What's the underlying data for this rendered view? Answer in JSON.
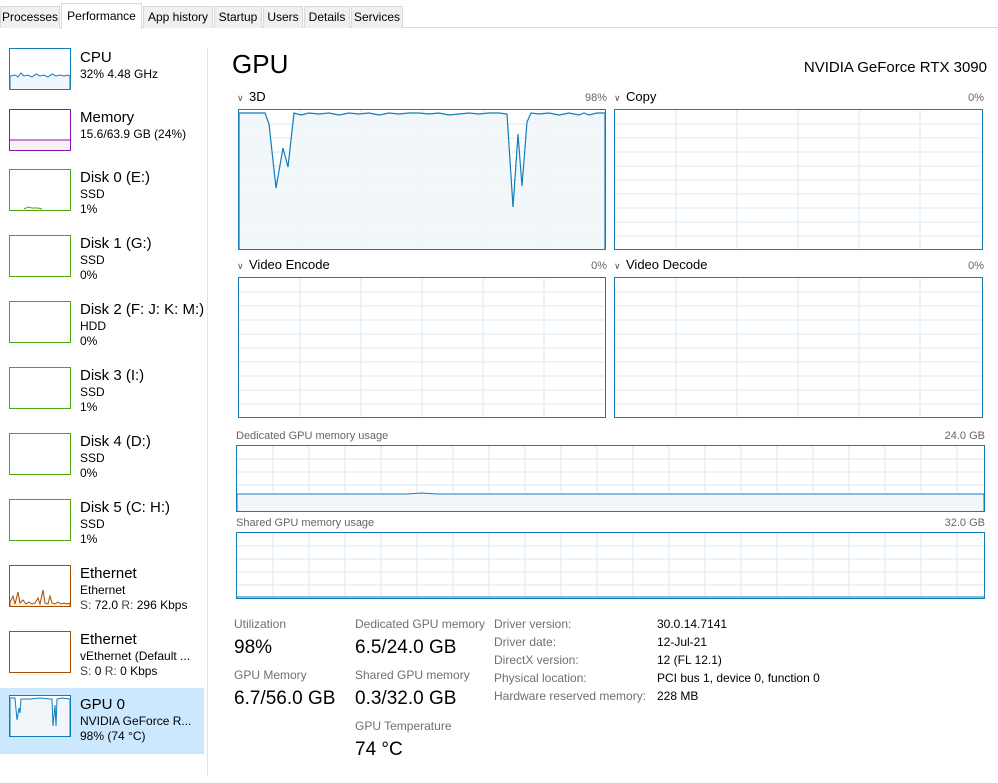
{
  "tabs": [
    "Processes",
    "Performance",
    "App history",
    "Startup",
    "Users",
    "Details",
    "Services"
  ],
  "active_tab": "Performance",
  "sidebar": {
    "items": [
      {
        "title": "CPU",
        "line1": "32%  4.48 GHz",
        "line2": "",
        "color": "#117dbb",
        "selected": false
      },
      {
        "title": "Memory",
        "line1": "15.6/63.9 GB (24%)",
        "line2": "",
        "color": "#8b12ae",
        "selected": false
      },
      {
        "title": "Disk 0 (E:)",
        "line1": "SSD",
        "line2": "1%",
        "color": "#4da60c",
        "selected": false
      },
      {
        "title": "Disk 1 (G:)",
        "line1": "SSD",
        "line2": "0%",
        "color": "#4da60c",
        "selected": false
      },
      {
        "title": "Disk 2 (F: J: K: M:)",
        "line1": "HDD",
        "line2": "0%",
        "color": "#4da60c",
        "selected": false
      },
      {
        "title": "Disk 3 (I:)",
        "line1": "SSD",
        "line2": "1%",
        "color": "#4da60c",
        "selected": false
      },
      {
        "title": "Disk 4 (D:)",
        "line1": "SSD",
        "line2": "0%",
        "color": "#4da60c",
        "selected": false
      },
      {
        "title": "Disk 5 (C: H:)",
        "line1": "SSD",
        "line2": "1%",
        "color": "#4da60c",
        "selected": false
      },
      {
        "title": "Ethernet",
        "line1": "Ethernet",
        "line2_s_label": "S:",
        "line2_s": "72.0",
        "line2_r_label": "R:",
        "line2_r": "296 Kbps",
        "color": "#a74f01",
        "selected": false
      },
      {
        "title": "Ethernet",
        "line1": "vEthernet (Default ...",
        "line2_s_label": "S:",
        "line2_s": "0",
        "line2_r_label": "R:",
        "line2_r": "0 Kbps",
        "color": "#a74f01",
        "selected": false
      },
      {
        "title": "GPU 0",
        "line1": "NVIDIA GeForce R...",
        "line2": "98% (74 °C)",
        "color": "#117dbb",
        "selected": true
      }
    ]
  },
  "main": {
    "title": "GPU",
    "model": "NVIDIA GeForce RTX 3090",
    "engines": [
      {
        "name": "3D",
        "percent": "98%"
      },
      {
        "name": "Copy",
        "percent": "0%"
      },
      {
        "name": "Video Encode",
        "percent": "0%"
      },
      {
        "name": "Video Decode",
        "percent": "0%"
      }
    ],
    "dedicated_memory": {
      "label": "Dedicated GPU memory usage",
      "max": "24.0 GB"
    },
    "shared_memory": {
      "label": "Shared GPU memory usage",
      "max": "32.0 GB"
    },
    "stats": {
      "utilization": {
        "label": "Utilization",
        "value": "98%"
      },
      "gpu_memory": {
        "label": "GPU Memory",
        "value": "6.7/56.0 GB"
      },
      "dedicated": {
        "label": "Dedicated GPU memory",
        "value": "6.5/24.0 GB"
      },
      "shared": {
        "label": "Shared GPU memory",
        "value": "0.3/32.0 GB"
      },
      "temperature": {
        "label": "GPU Temperature",
        "value": "74 °C"
      }
    },
    "info": [
      {
        "label": "Driver version:",
        "value": "30.0.14.7141"
      },
      {
        "label": "Driver date:",
        "value": "12-Jul-21"
      },
      {
        "label": "DirectX version:",
        "value": "12 (FL 12.1)"
      },
      {
        "label": "Physical location:",
        "value": "PCI bus 1, device 0, function 0"
      },
      {
        "label": "Hardware reserved memory:",
        "value": "228 MB"
      }
    ]
  },
  "colors": {
    "gpu_accent": "#117dbb",
    "gpu_fill": "#f1f6fa",
    "grid": "#d9eaf4",
    "selected_bg": "#cce8ff"
  }
}
